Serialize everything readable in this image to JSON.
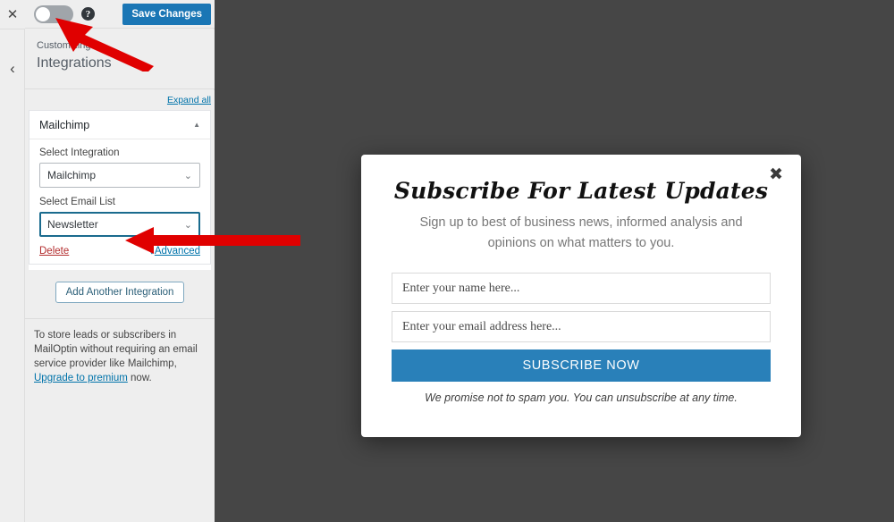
{
  "customizer": {
    "rail": {
      "close_icon": "close-icon",
      "back_icon": "chevron-left-icon"
    },
    "header": {
      "toggle_state": "off",
      "help_label": "?",
      "save_label": "Save Changes"
    },
    "title": {
      "eyebrow": "Customizing",
      "heading": "Integrations"
    },
    "expand_all_label": "Expand all",
    "panel": {
      "title": "Mailchimp",
      "caret": "▲",
      "fields": [
        {
          "label": "Select Integration",
          "value": "Mailchimp",
          "focused": false
        },
        {
          "label": "Select Email List",
          "value": "Newsletter",
          "focused": true
        }
      ],
      "delete_label": "Delete",
      "advanced_arrow": "↓",
      "advanced_label": "Advanced"
    },
    "add_integration_label": "Add Another Integration",
    "notice": {
      "text_before": "To store leads or subscribers in MailOptin without requiring an email service provider like Mailchimp, ",
      "link_text": "Upgrade to premium",
      "text_after": " now."
    }
  },
  "preview": {
    "overlay_color": "#464646",
    "modal": {
      "close_icon": "✖",
      "title": "Subscribe For Latest Updates",
      "subtitle": "Sign up to best of business news, informed analysis and opinions on what matters to you.",
      "name_placeholder": "Enter your name here...",
      "email_placeholder": "Enter your email address here...",
      "name_value": "",
      "email_value": "",
      "submit_label": "SUBSCRIBE NOW",
      "footnote": "We promise not to spam you. You can unsubscribe at any time.",
      "accent_color": "#2980b9"
    }
  },
  "annotations": {
    "arrow_color": "#e00000",
    "arrows": [
      {
        "name": "arrow-pointing-to-toggle",
        "target": "toggle-switch"
      },
      {
        "name": "arrow-pointing-to-email-list-select",
        "target": "email-list-select"
      }
    ]
  }
}
